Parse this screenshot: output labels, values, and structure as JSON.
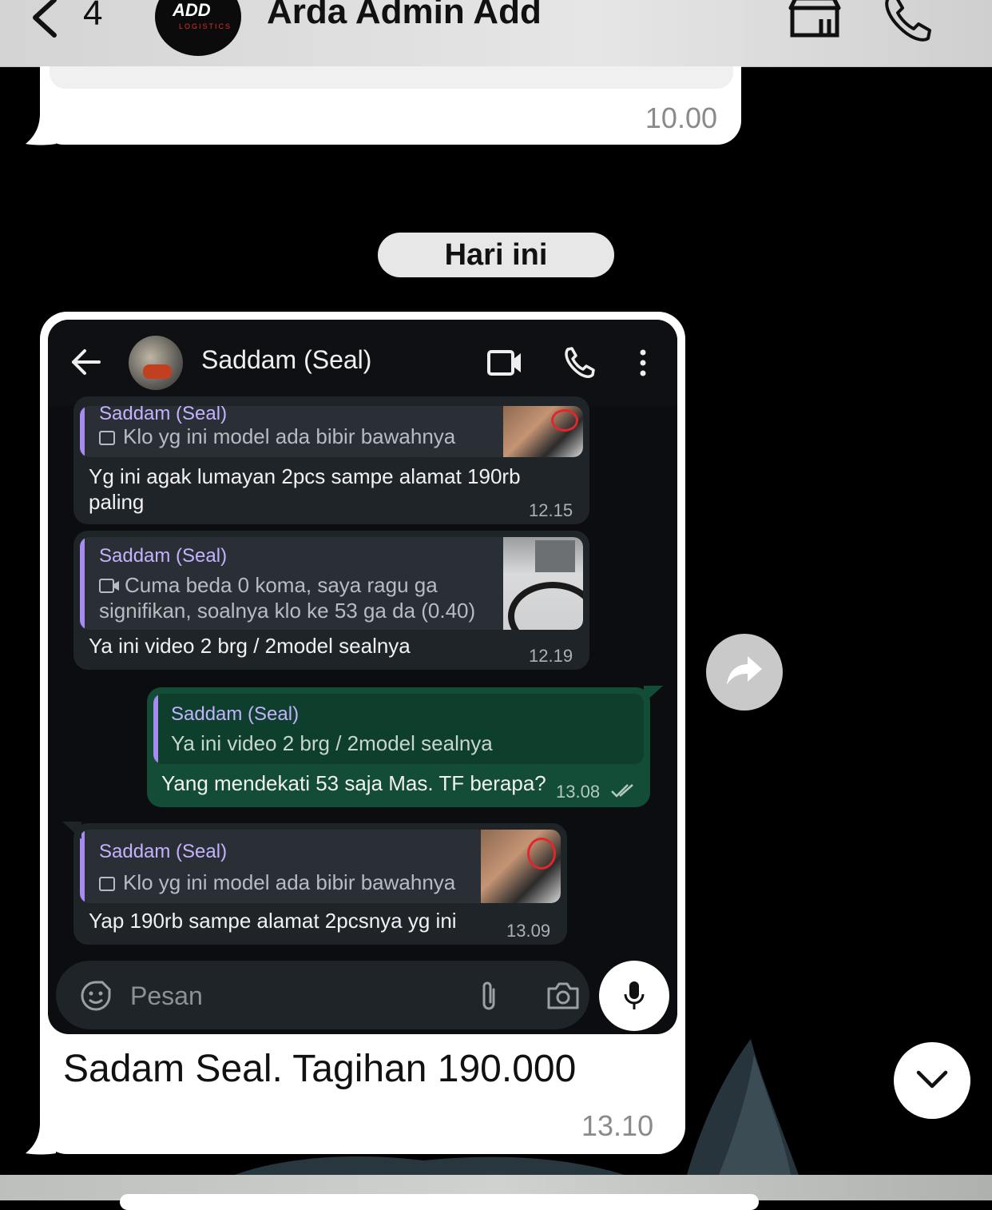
{
  "header": {
    "back_count": "4",
    "contact_name": "Arda Admin Add",
    "logo_text": "ADD",
    "logo_subtext": "LOGISTICS"
  },
  "previous_message": {
    "time": "10.00"
  },
  "date_divider": "Hari ini",
  "message": {
    "caption": "Sadam Seal. Tagihan 190.000",
    "time": "13.10"
  },
  "screenshot": {
    "contact_name": "Saddam (Seal)",
    "messages": [
      {
        "quote_name": "Saddam (Seal)",
        "quote_text": "Klo yg ini model ada bibir bawahnya",
        "text_line1": "Yg ini agak lumayan 2pcs sampe alamat 190rb",
        "text_line2": "paling",
        "time": "12.15"
      },
      {
        "quote_name": "Saddam (Seal)",
        "quote_text_line1": "Cuma beda 0 koma, saya ragu ga",
        "quote_text_line2": "signifikan, soalnya klo ke 53 ga da (0.40)",
        "text": "Ya ini video 2 brg / 2model sealnya",
        "time": "12.19"
      },
      {
        "quote_name": "Saddam (Seal)",
        "quote_text": "Ya ini video 2 brg / 2model sealnya",
        "text": "Yang mendekati 53 saja Mas. TF berapa?",
        "time": "13.08"
      },
      {
        "quote_name": "Saddam (Seal)",
        "quote_text": "Klo yg ini model ada bibir bawahnya",
        "text": "Yap 190rb sampe alamat 2pcsnya yg ini",
        "time": "13.09"
      }
    ],
    "input_placeholder": "Pesan"
  },
  "colors": {
    "incoming_bubble": "#1f2429",
    "outgoing_bubble": "#134d37",
    "quote_accent": "#a68bf1"
  }
}
